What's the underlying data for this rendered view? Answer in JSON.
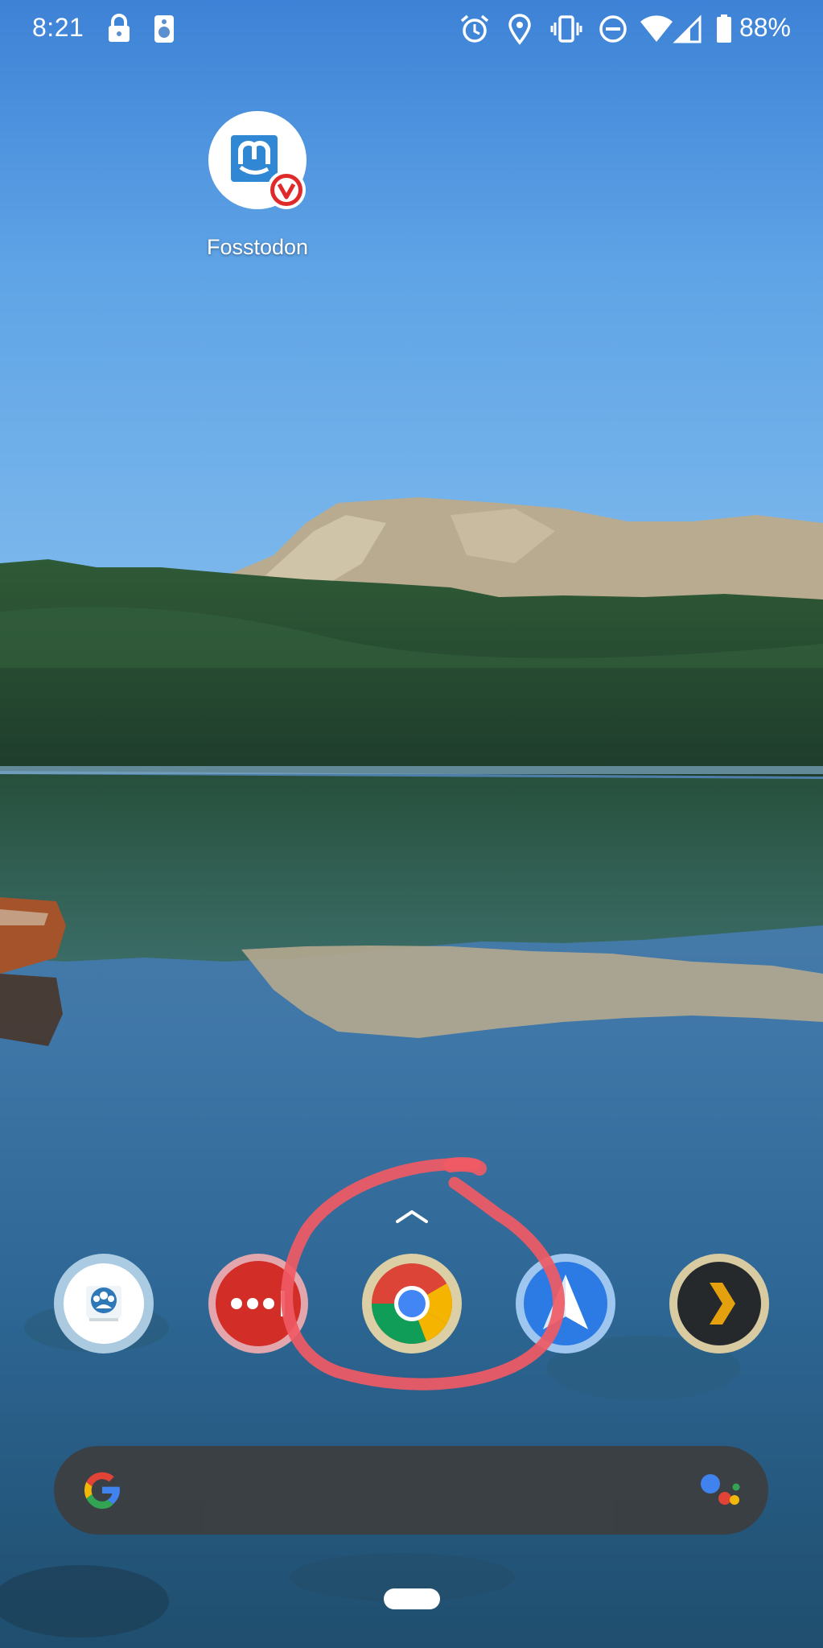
{
  "status_bar": {
    "time": "8:21",
    "battery_percent": "88%",
    "icons": [
      "lock-icon",
      "speaker-icon",
      "alarm-icon",
      "location-icon",
      "vibrate-icon",
      "do-not-disturb-icon",
      "wifi-icon",
      "cellular-signal-icon",
      "battery-icon"
    ]
  },
  "desktop": {
    "shortcut": {
      "label": "Fosstodon",
      "icon": "mastodon-icon",
      "badge_icon": "vivaldi-badge-icon"
    }
  },
  "drawer_handle": {
    "icon": "chevron-up-icon"
  },
  "dock": {
    "apps": [
      {
        "icon": "contacts-app-icon"
      },
      {
        "icon": "lastpass-app-icon"
      },
      {
        "icon": "chrome-app-icon",
        "annotated": true
      },
      {
        "icon": "navigation-app-icon"
      },
      {
        "icon": "plex-app-icon"
      }
    ]
  },
  "search_bar": {
    "left_icon": "google-g-icon",
    "right_icon": "google-assistant-icon"
  },
  "colors": {
    "annotation_stroke": "#f05a64",
    "search_bar_bg": "#3b3f42",
    "chrome_red": "#db4437",
    "chrome_yellow": "#f4b400",
    "chrome_green": "#0f9d58",
    "chrome_blue": "#4285f4"
  }
}
